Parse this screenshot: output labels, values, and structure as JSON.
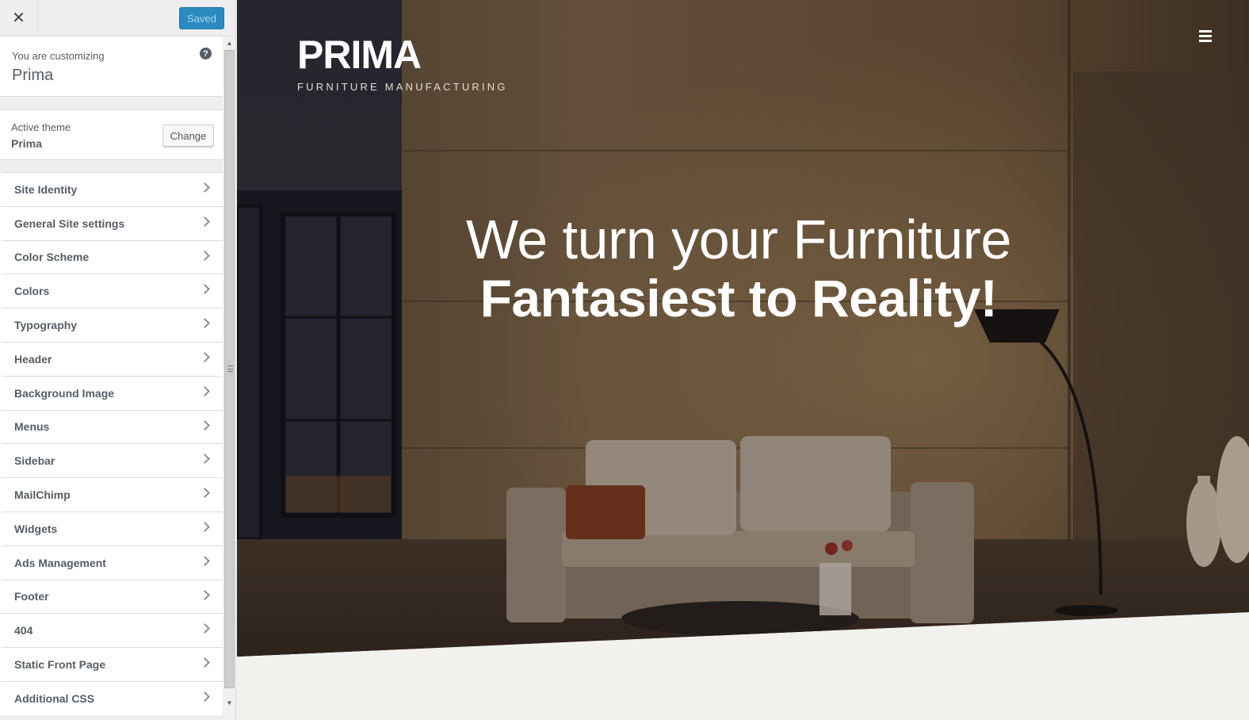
{
  "toolbar": {
    "close_icon": "close-icon",
    "saved_label": "Saved",
    "saved_color": "#2a8bc0"
  },
  "info": {
    "label": "You are customizing",
    "title": "Prima",
    "help_icon": "?"
  },
  "theme": {
    "label": "Active theme",
    "name": "Prima",
    "change_label": "Change"
  },
  "panels": [
    {
      "label": "Site Identity"
    },
    {
      "label": "General Site settings"
    },
    {
      "label": "Color Scheme"
    },
    {
      "label": "Colors"
    },
    {
      "label": "Typography"
    },
    {
      "label": "Header"
    },
    {
      "label": "Background Image"
    },
    {
      "label": "Menus"
    },
    {
      "label": "Sidebar"
    },
    {
      "label": "MailChimp"
    },
    {
      "label": "Widgets"
    },
    {
      "label": "Ads Management"
    },
    {
      "label": "Footer"
    },
    {
      "label": "404"
    },
    {
      "label": "Static Front Page"
    },
    {
      "label": "Additional CSS"
    }
  ],
  "preview": {
    "site_title": "PRIMA",
    "tagline": "FURNITURE MANUFACTURING",
    "menu_icon": "hamburger-menu-icon",
    "hero_line1": "We turn your Furniture",
    "hero_line2": "Fantasiest to Reality!"
  }
}
